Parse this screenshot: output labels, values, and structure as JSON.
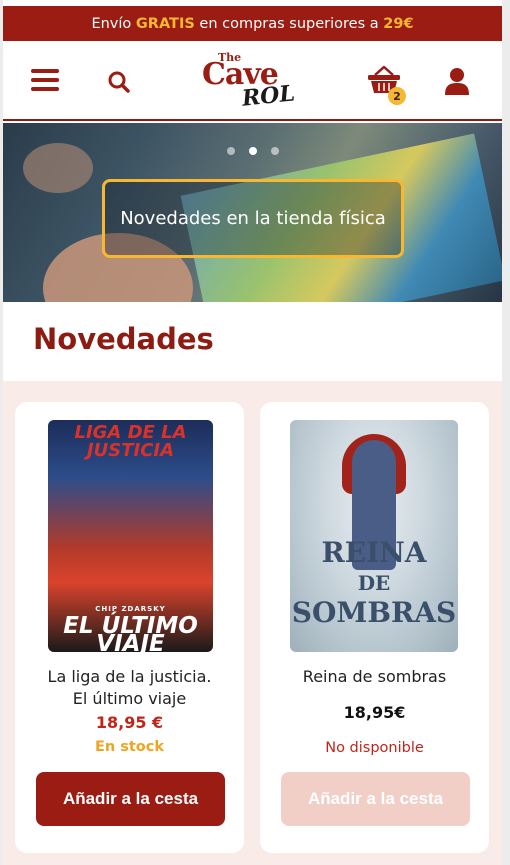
{
  "promo": {
    "prefix": "Envío",
    "highlight": "GRATIS",
    "middle": "en compras superiores a",
    "amount": "29€"
  },
  "header": {
    "logo": {
      "the": "The",
      "cave": "Cave",
      "rol": "ROL"
    },
    "cart_count": "2",
    "icons": [
      "menu-icon",
      "search-icon",
      "cart-icon",
      "user-icon"
    ]
  },
  "hero": {
    "button_label": "Novedades en la tienda física",
    "slides": 3,
    "active_slide": 2
  },
  "section": {
    "title": "Novedades"
  },
  "products": [
    {
      "cover_text_top": "LIGA DE LA JUSTICIA",
      "cover_author": "CHIP ZDARSKY",
      "cover_text_bottom": "EL ÚLTIMO VIAJE",
      "name_line1": "La liga de la justicia.",
      "name_line2": "El último viaje",
      "price": "18,95 €",
      "stock": "En stock",
      "button": "Añadir a la cesta",
      "available": true
    },
    {
      "cover_line1": "REINA",
      "cover_line2": "DE",
      "cover_line3": "SOMBRAS",
      "name_line1": "Reina de sombras",
      "price": "18,95€",
      "stock": "No disponible",
      "button": "Añadir a la cesta",
      "available": false
    }
  ],
  "colors": {
    "brand": "#9b1c12",
    "accent": "#f7b733",
    "list_background": "#f9ebe7",
    "disabled_button": "#f2cfc6"
  }
}
